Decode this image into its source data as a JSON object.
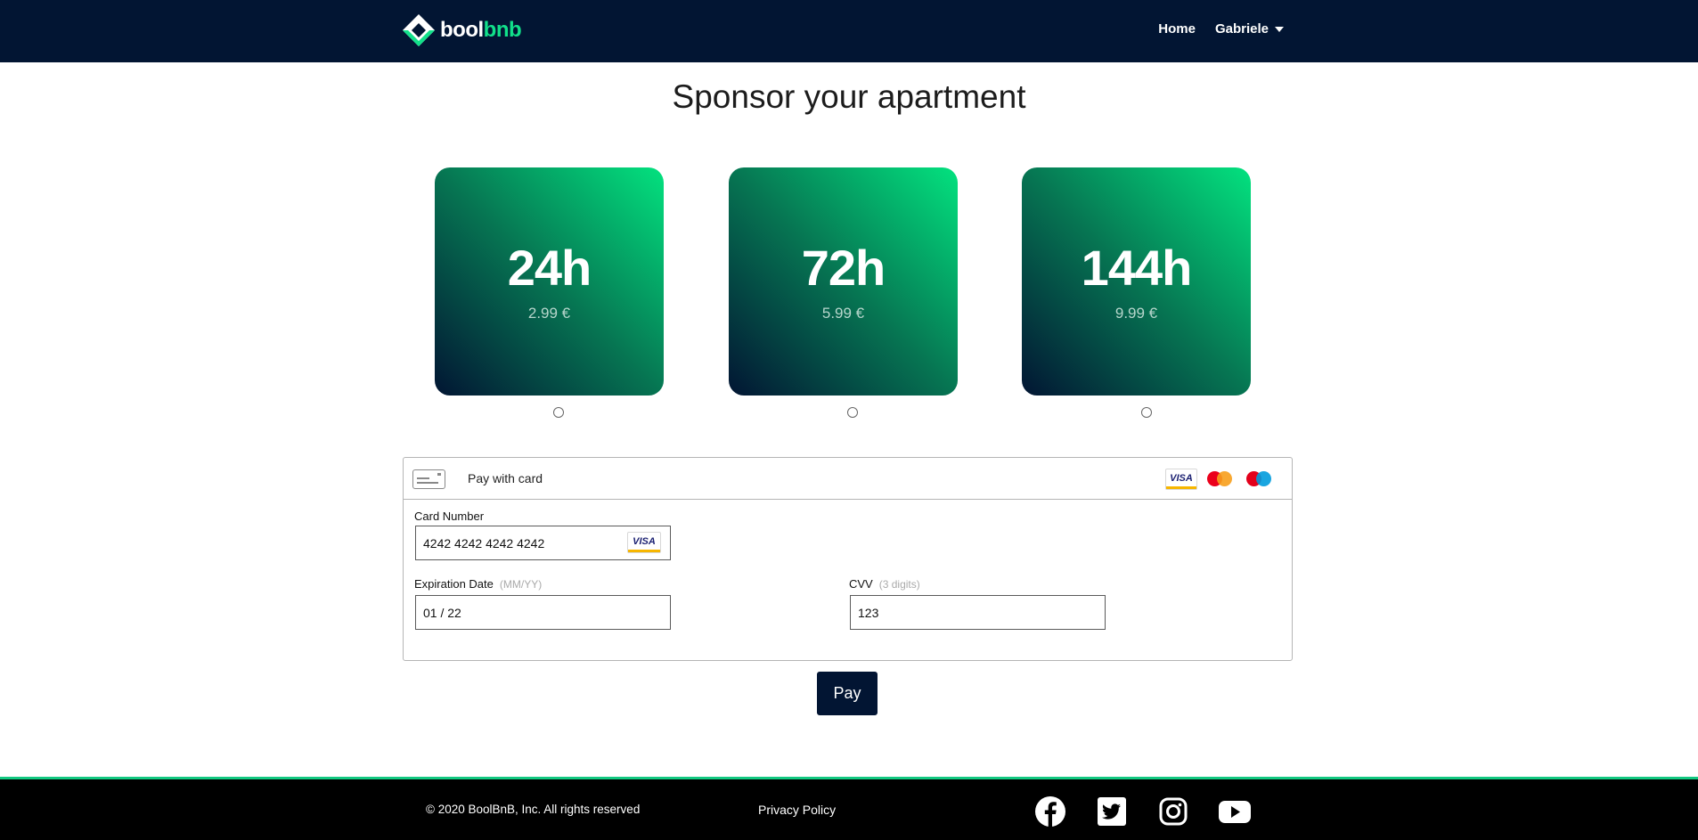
{
  "navbar": {
    "logo_text_white": "bool",
    "logo_text_green": "bnb",
    "home_label": "Home",
    "user_label": "Gabriele"
  },
  "page": {
    "title": "Sponsor your apartment"
  },
  "plans": [
    {
      "duration": "24h",
      "price": "2.99 €"
    },
    {
      "duration": "72h",
      "price": "5.99 €"
    },
    {
      "duration": "144h",
      "price": "9.99 €"
    }
  ],
  "payment": {
    "header_label": "Pay with card",
    "card_number_label": "Card Number",
    "card_number_value": "4242 4242 4242 4242",
    "expiration_label": "Expiration Date",
    "expiration_hint": "(MM/YY)",
    "expiration_value": "01 / 22",
    "cvv_label": "CVV",
    "cvv_hint": "(3 digits)",
    "cvv_value": "123",
    "visa_text": "VISA"
  },
  "pay_button_label": "Pay",
  "footer": {
    "copyright": "© 2020 BoolBnB, Inc. All rights reserved",
    "privacy_label": "Privacy Policy",
    "social_icons": [
      "facebook-icon",
      "twitter-icon",
      "instagram-icon",
      "youtube-icon"
    ]
  },
  "colors": {
    "navy": "#021533",
    "accent_green": "#11e08a"
  }
}
